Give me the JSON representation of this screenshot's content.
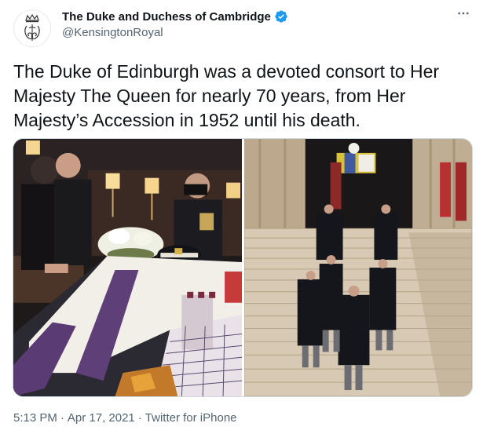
{
  "tweet": {
    "author": {
      "display_name": "The Duke and Duchess of Cambridge",
      "handle": "@KensingtonRoyal",
      "verified": true,
      "avatar_icon": "royal-cypher-crest-icon"
    },
    "more_icon": "more-horizontal-icon",
    "text": "The Duke of Edinburgh was a devoted consort to Her\nMajesty The Queen for nearly 70 years, from Her\nMajesty’s Accession in 1952 until his death.",
    "media": [
      {
        "description_icon": "coffin-photo",
        "kind": "photo"
      },
      {
        "description_icon": "procession-steps-photo",
        "kind": "photo"
      }
    ],
    "time": "5:13 PM",
    "date": "Apr 17, 2021",
    "separator": "·",
    "source": "Twitter for iPhone"
  },
  "colors": {
    "text": "#0f1419",
    "secondary": "#536471",
    "verified_blue": "#1d9bf0",
    "border": "#cfd9de"
  }
}
